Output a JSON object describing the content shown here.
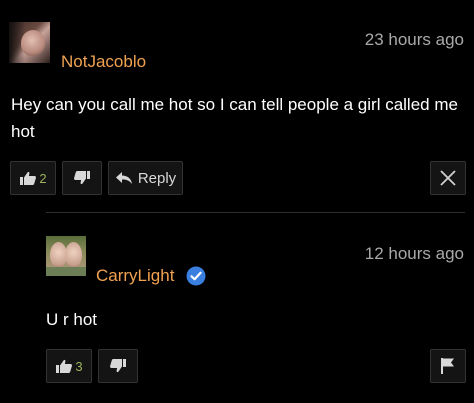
{
  "comment": {
    "username": "NotJacoblo",
    "timestamp": "23 hours ago",
    "text": "Hey can you call me hot so I can tell people a girl called me hot",
    "likes": "2",
    "reply_label": "Reply"
  },
  "reply": {
    "username": "CarryLight",
    "timestamp": "12 hours ago",
    "text": "U r hot",
    "likes": "3"
  },
  "colors": {
    "username": "#f0a250",
    "verified": "#3a7ee0",
    "count": "#9bb35a"
  }
}
